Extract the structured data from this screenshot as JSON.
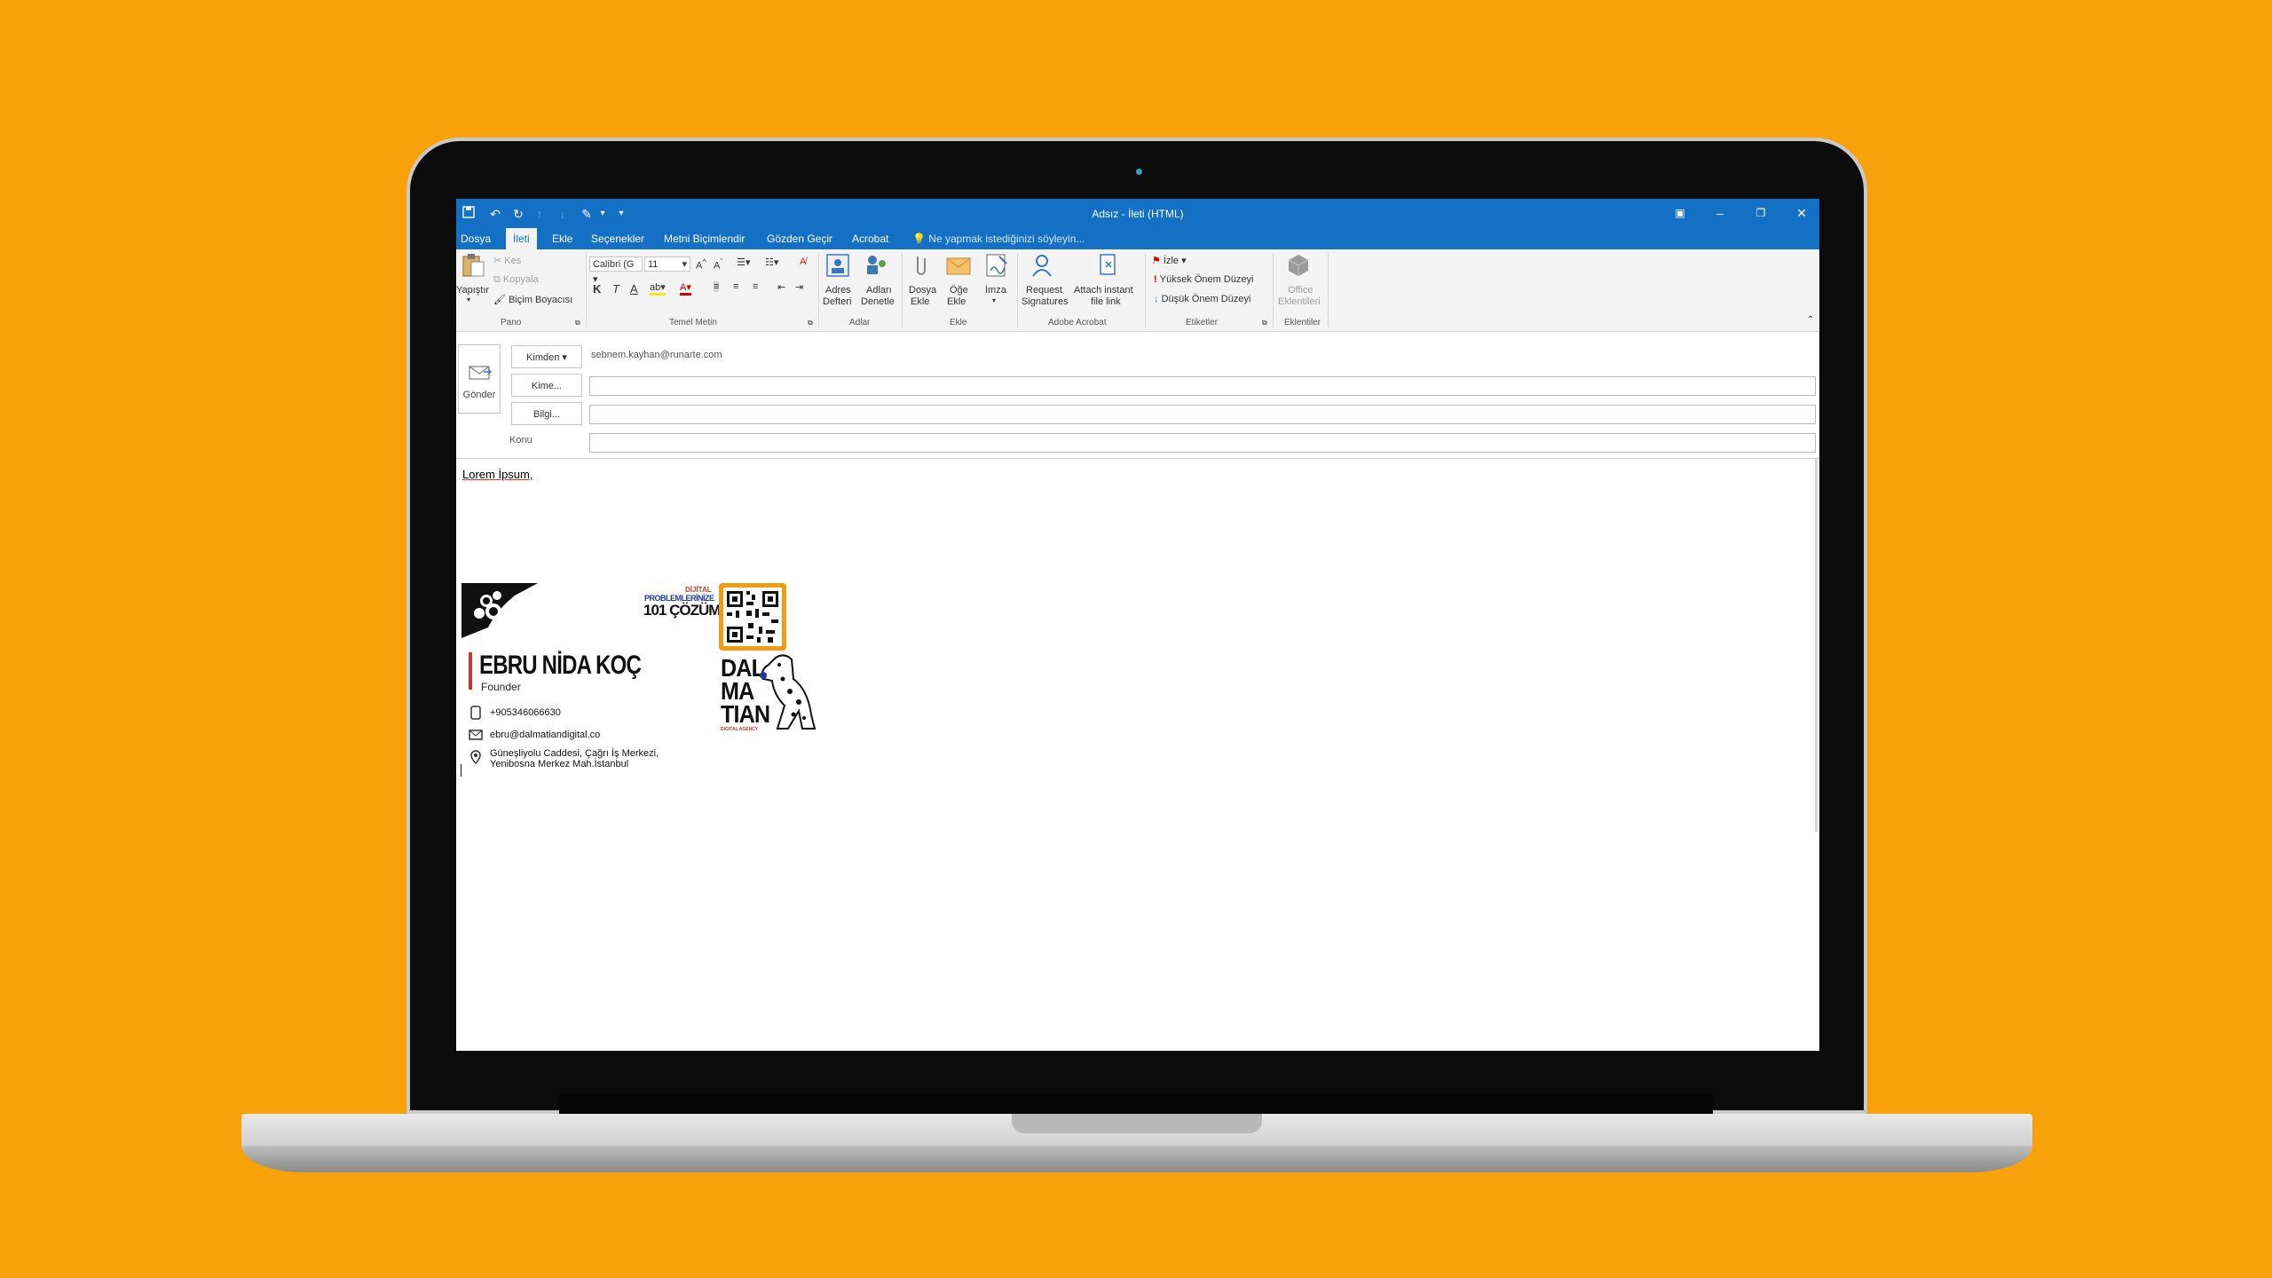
{
  "window": {
    "title": "Adsız - İleti (HTML)"
  },
  "tabs": [
    "Dosya",
    "İleti",
    "Ekle",
    "Seçenekler",
    "Metni Biçimlendir",
    "Gözden Geçir",
    "Acrobat"
  ],
  "tell_me": "Ne yapmak istediğinizi söyleyin...",
  "ribbon": {
    "pano": {
      "paste": "Yapıştır",
      "cut": "Kes",
      "copy": "Kopyala",
      "painter": "Biçim Boyacısı",
      "label": "Pano"
    },
    "font": {
      "family": "Calibri (G",
      "size": "11",
      "bold": "K",
      "italic": "T",
      "underline": "A",
      "label": "Temel Metin"
    },
    "adlar": {
      "address_book_1": "Adres",
      "address_book_2": "Defteri",
      "check_names_1": "Adları",
      "check_names_2": "Denetle",
      "label": "Adlar"
    },
    "ekle": {
      "attach_file_1": "Dosya",
      "attach_file_2": "Ekle",
      "attach_item_1": "Öğe",
      "attach_item_2": "Ekle",
      "signature": "İmza",
      "label": "Ekle"
    },
    "acrobat": {
      "request_1": "Request",
      "request_2": "Signatures",
      "attach_link_1": "Attach instant",
      "attach_link_2": "file link",
      "label": "Adobe Acrobat"
    },
    "etiketler": {
      "follow": "İzle",
      "high": "Yüksek Önem Düzeyi",
      "low": "Düşük Önem Düzeyi",
      "label": "Etiketler"
    },
    "eklentiler": {
      "office_1": "Office",
      "office_2": "Eklentileri",
      "label": "Eklentiler"
    }
  },
  "header": {
    "send": "Gönder",
    "from_btn": "Kimden",
    "from_address": "sebnem.kayhan@runarte.com",
    "to_btn": "Kime...",
    "cc_btn": "Bilgi...",
    "subject_label": "Konu"
  },
  "message": {
    "greeting": "Lorem İpsum,"
  },
  "signature": {
    "name": "EBRU NİDA KOÇ",
    "role": "Founder",
    "phone": "+905346066630",
    "email": "ebru@dalmatiandigital.co",
    "address_1": "Güneşliyolu Caddesi, Çağrı İş Merkezi,",
    "address_2": "Yenibosna Merkez Mah.İstanbul",
    "promo_1": "DİJİTAL",
    "promo_2": "PROBLEMLERİNİZE",
    "promo_3": "101 ÇÖZÜM",
    "brand_1": "DAL",
    "brand_2": "MA",
    "brand_3": "TIAN",
    "brand_sub": "DIGITAL AGENCY"
  },
  "colors": {
    "background": "#F9A109",
    "accent": "#1470C4",
    "signature_bar": "#C0392B",
    "qr_frame": "#F39C12"
  }
}
